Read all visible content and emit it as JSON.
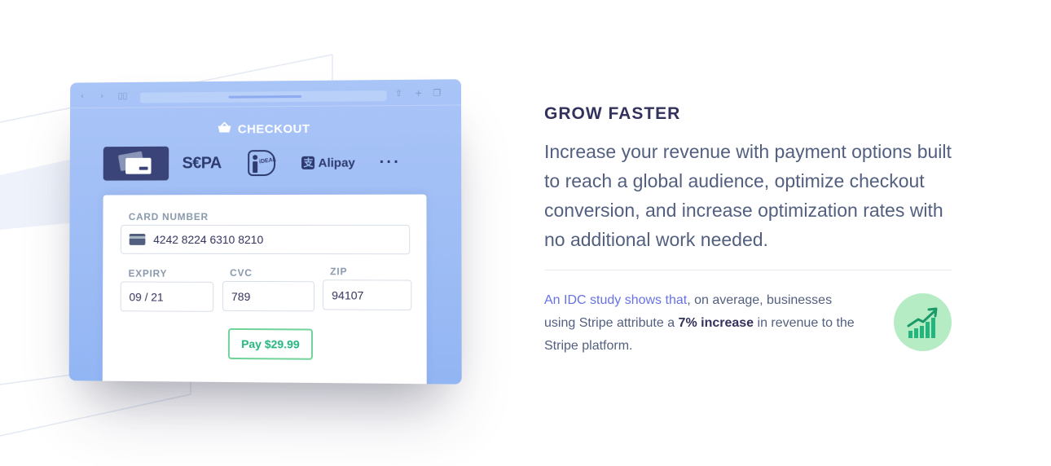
{
  "checkout": {
    "title": "CHECKOUT",
    "methods": {
      "sepa": "S€PA",
      "ideal": "iDEAL",
      "alipay": "Alipay",
      "more": "···"
    },
    "form": {
      "card_number_label": "CARD NUMBER",
      "card_number_value": "4242 8224 6310 8210",
      "expiry_label": "EXPIRY",
      "expiry_value": "09 / 21",
      "cvc_label": "CVC",
      "cvc_value": "789",
      "zip_label": "ZIP",
      "zip_value": "94107",
      "pay_label": "Pay $29.99"
    }
  },
  "content": {
    "eyebrow": "GROW FASTER",
    "lead": "Increase your revenue with payment options built to reach a global audience, optimize checkout conversion, and increase optimization rates with no additional work needed.",
    "note_link": "An IDC study shows that",
    "note_mid": ", on average, businesses using Stripe attribute a ",
    "note_strong": "7% increase",
    "note_end": " in revenue to the Stripe platform."
  },
  "colors": {
    "accent": "#6772e5",
    "heading": "#32325d",
    "body": "#525f7f",
    "success": "#24b47e",
    "browser_blue": "#9dbcf5",
    "badge_green": "#b5ecc4"
  },
  "icons": [
    "back-arrow-icon",
    "forward-arrow-icon",
    "bookmarks-icon",
    "share-icon",
    "new-tab-icon",
    "tabs-icon",
    "basket-icon",
    "credit-card-icon",
    "growth-chart-icon"
  ]
}
